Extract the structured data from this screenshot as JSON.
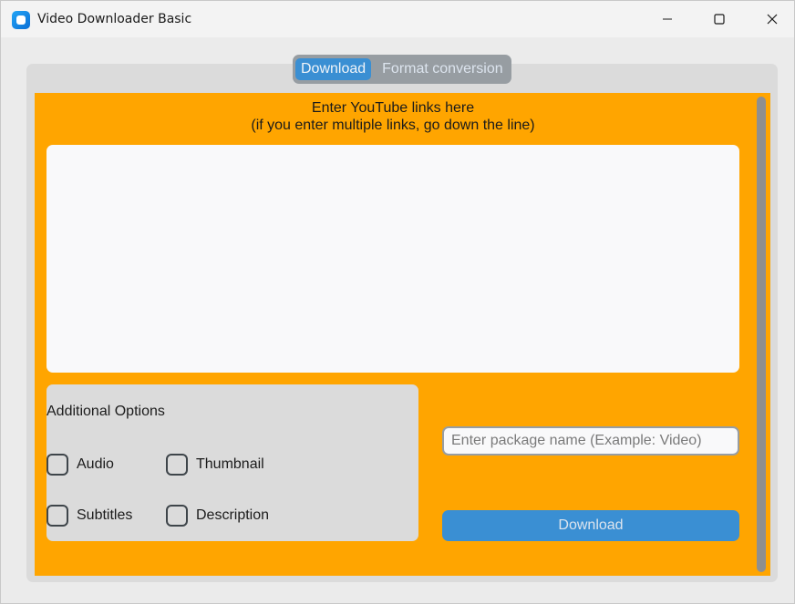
{
  "window": {
    "title": "Video Downloader Basic"
  },
  "tabs": [
    {
      "label": "Download",
      "active": true
    },
    {
      "label": "Format conversion",
      "active": false
    }
  ],
  "download_tab": {
    "instructions_line1": "Enter YouTube links here",
    "instructions_line2": "(if you enter multiple links, go down the line)",
    "links_value": "",
    "options": {
      "title": "Additional Options",
      "checkboxes": [
        {
          "label": "Audio",
          "checked": false
        },
        {
          "label": "Thumbnail",
          "checked": false
        },
        {
          "label": "Subtitles",
          "checked": false
        },
        {
          "label": "Description",
          "checked": false
        }
      ]
    },
    "package_name": {
      "value": "",
      "placeholder": "Enter package name (Example: Video)"
    },
    "download_button_label": "Download"
  },
  "colors": {
    "content_background": "#ffa500",
    "accent": "#3a8fd3",
    "panel": "#dbdbdb",
    "segmented_background": "#979da2"
  },
  "icons": {
    "app": "app-icon",
    "minimize": "minimize-icon",
    "maximize": "maximize-icon",
    "close": "close-icon"
  }
}
